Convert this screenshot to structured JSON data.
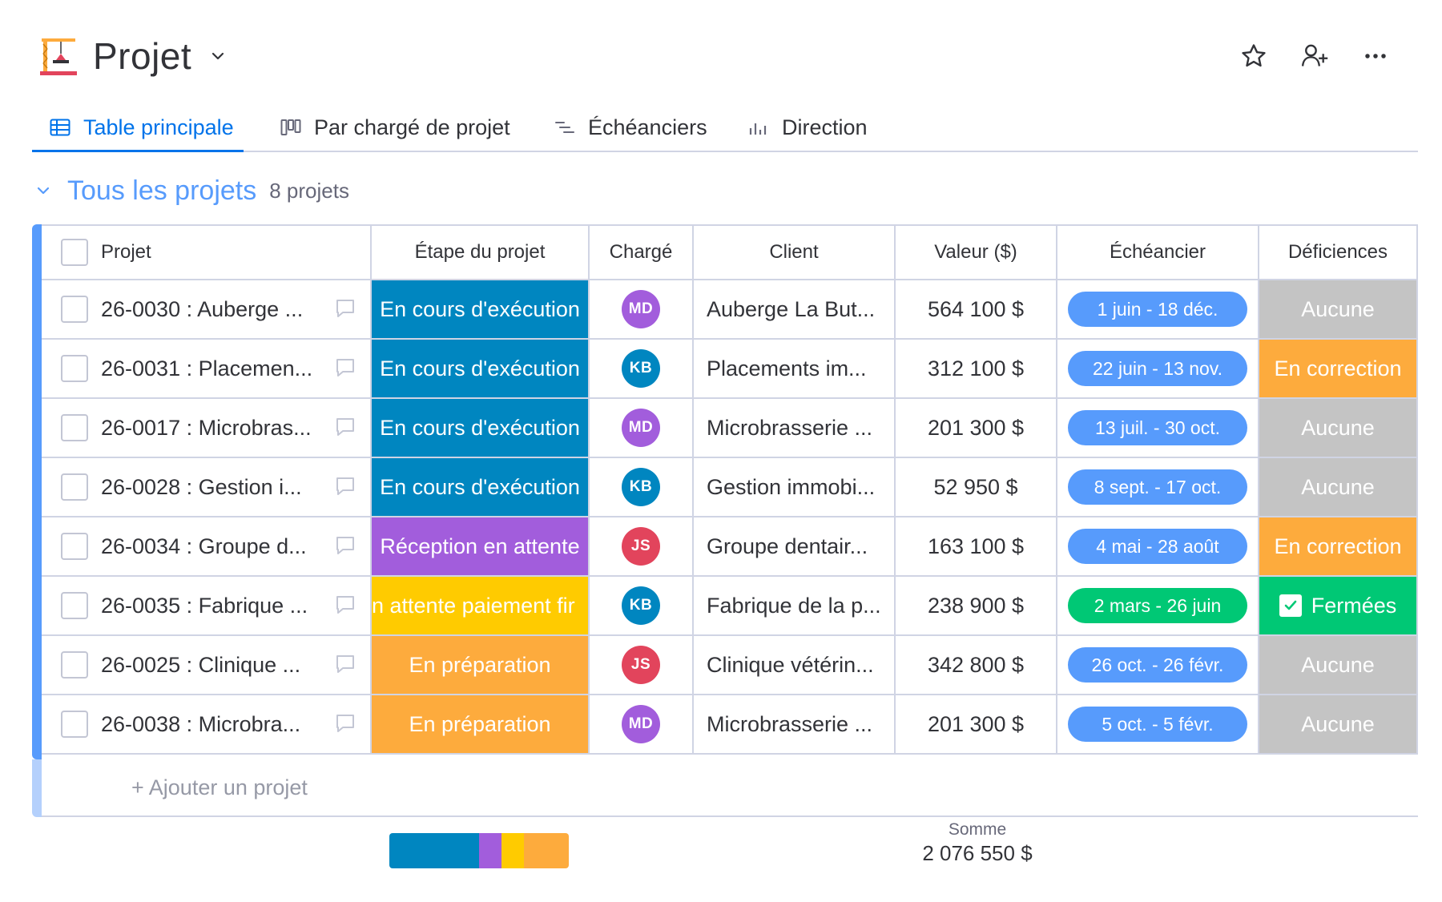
{
  "header": {
    "title": "Projet"
  },
  "tabs": [
    {
      "label": "Table principale",
      "icon": "table-icon",
      "active": true
    },
    {
      "label": "Par chargé de projet",
      "icon": "kanban-icon",
      "active": false
    },
    {
      "label": "Échéanciers",
      "icon": "gantt-icon",
      "active": false
    },
    {
      "label": "Direction",
      "icon": "chart-icon",
      "active": false
    }
  ],
  "group": {
    "title": "Tous les projets",
    "count": "8 projets",
    "color": "#579bfc"
  },
  "columns": {
    "project": "Projet",
    "stage": "Étape du projet",
    "owner": "Chargé",
    "client": "Client",
    "value": "Valeur ($)",
    "schedule": "Échéancier",
    "deficiencies": "Déficiences"
  },
  "rows": [
    {
      "name": "26-0030 : Auberge ...",
      "stage": "En cours d'exécution",
      "stage_color": "#0086c0",
      "owner": "MD",
      "owner_color": "#a25ddc",
      "client": "Auberge La But...",
      "value": "564 100 $",
      "schedule": "1 juin - 18 déc.",
      "schedule_color": "#579bfc",
      "def": "Aucune",
      "def_color": "#c4c4c4"
    },
    {
      "name": "26-0031 : Placemen...",
      "stage": "En cours d'exécution",
      "stage_color": "#0086c0",
      "owner": "KB",
      "owner_color": "#0086c0",
      "client": "Placements im...",
      "value": "312 100 $",
      "schedule": "22 juin - 13 nov.",
      "schedule_color": "#579bfc",
      "def": "En correction",
      "def_color": "#fdab3d"
    },
    {
      "name": "26-0017 : Microbras...",
      "stage": "En cours d'exécution",
      "stage_color": "#0086c0",
      "owner": "MD",
      "owner_color": "#a25ddc",
      "client": "Microbrasserie ...",
      "value": "201 300 $",
      "schedule": "13 juil. - 30 oct.",
      "schedule_color": "#579bfc",
      "def": "Aucune",
      "def_color": "#c4c4c4"
    },
    {
      "name": "26-0028 : Gestion i...",
      "stage": "En cours d'exécution",
      "stage_color": "#0086c0",
      "owner": "KB",
      "owner_color": "#0086c0",
      "client": "Gestion immobi...",
      "value": "52 950 $",
      "schedule": "8 sept. - 17 oct.",
      "schedule_color": "#579bfc",
      "def": "Aucune",
      "def_color": "#c4c4c4"
    },
    {
      "name": "26-0034 : Groupe d...",
      "stage": "Réception en attente",
      "stage_color": "#a25ddc",
      "owner": "JS",
      "owner_color": "#e2445c",
      "client": "Groupe dentair...",
      "value": "163 100 $",
      "schedule": "4 mai - 28 août",
      "schedule_color": "#579bfc",
      "def": "En correction",
      "def_color": "#fdab3d"
    },
    {
      "name": "26-0035 : Fabrique ...",
      "stage": "n attente paiement fir",
      "stage_color": "#ffcb00",
      "owner": "KB",
      "owner_color": "#0086c0",
      "client": "Fabrique de la p...",
      "value": "238 900 $",
      "schedule": "2 mars - 26 juin",
      "schedule_color": "#00c875",
      "def": "Fermées",
      "def_color": "#00c875",
      "def_check": true
    },
    {
      "name": "26-0025 : Clinique ...",
      "stage": "En préparation",
      "stage_color": "#fdab3d",
      "owner": "JS",
      "owner_color": "#e2445c",
      "client": "Clinique vétérin...",
      "value": "342 800 $",
      "schedule": "26 oct. - 26 févr.",
      "schedule_color": "#579bfc",
      "def": "Aucune",
      "def_color": "#c4c4c4"
    },
    {
      "name": "26-0038 : Microbra...",
      "stage": "En préparation",
      "stage_color": "#fdab3d",
      "owner": "MD",
      "owner_color": "#a25ddc",
      "client": "Microbrasserie ...",
      "value": "201 300 $",
      "schedule": "5 oct. - 5 févr.",
      "schedule_color": "#579bfc",
      "def": "Aucune",
      "def_color": "#c4c4c4"
    }
  ],
  "add_row": "+ Ajouter un projet",
  "summary": {
    "label": "Somme",
    "value": "2 076 550 $",
    "stage_distribution": [
      {
        "color": "#0086c0",
        "fraction": 0.5
      },
      {
        "color": "#a25ddc",
        "fraction": 0.125
      },
      {
        "color": "#ffcb00",
        "fraction": 0.125
      },
      {
        "color": "#fdab3d",
        "fraction": 0.25
      }
    ]
  }
}
